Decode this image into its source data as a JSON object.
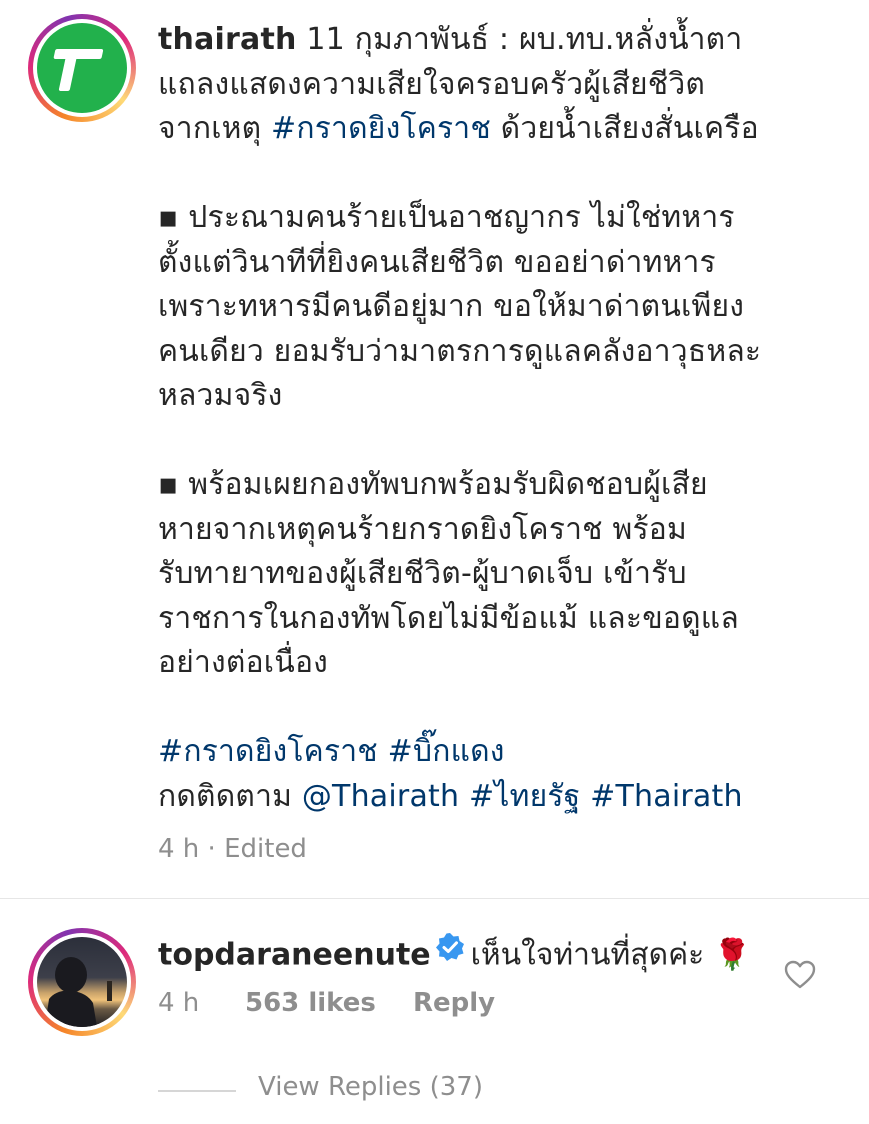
{
  "post": {
    "username": "thairath",
    "caption_lead": " 11 กุมภาพันธ์ : ผบ.ทบ.หลั่งน้ำตา",
    "line2": "แถลงแสดงความเสียใจครอบครัวผู้เสียชีวิต",
    "line3_pre": "จากเหตุ ",
    "line3_tag": "#กราดยิงโคราช",
    "line3_post": " ด้วยน้ำเสียงสั่นเครือ",
    "bullet1": [
      "▪ ประณามคนร้ายเป็นอาชญากร ไม่ใช่ทหาร",
      "ตั้งแต่วินาทีที่ยิงคนเสียชีวิต ขออย่าด่าทหาร",
      "เพราะทหารมีคนดีอยู่มาก ขอให้มาด่าตนเพียง",
      "คนเดียว ยอมรับว่ามาตรการดูแลคลังอาวุธหละ",
      "หลวมจริง"
    ],
    "bullet2": [
      "▪ พร้อมเผยกองทัพบกพร้อมรับผิดชอบผู้เสีย",
      "หายจากเหตุคนร้ายกราดยิงโคราช พร้อม",
      "รับทายาทของผู้เสียชีวิต-ผู้บาดเจ็บ เข้ารับ",
      "ราชการในกองทัพโดยไม่มีข้อแม้ และขอดูแล",
      "อย่างต่อเนื่อง"
    ],
    "tag1": "#กราดยิงโคราช",
    "tag2": "#บิ๊กแดง",
    "follow_pre": "กดติดตาม ",
    "follow_mention": "@Thairath",
    "follow_tag1": "#ไทยรัฐ",
    "follow_tag2": "#Thairath",
    "time": "4 h",
    "edited": " · Edited"
  },
  "comment": {
    "username": "topdaraneenute",
    "text": "เห็นใจท่านที่สุดค่ะ",
    "emoji": "🌹",
    "time": "4 h",
    "likes": "563 likes",
    "reply": "Reply",
    "view_replies": "View Replies (37)"
  },
  "colors": {
    "link": "#00376b",
    "muted": "#8e8e8e",
    "verified": "#3897f0",
    "thairath_logo": "#22b14c"
  },
  "icons": {
    "post_avatar": "thairath-logo",
    "verified": "verified-badge-icon",
    "like": "heart-outline-icon"
  }
}
